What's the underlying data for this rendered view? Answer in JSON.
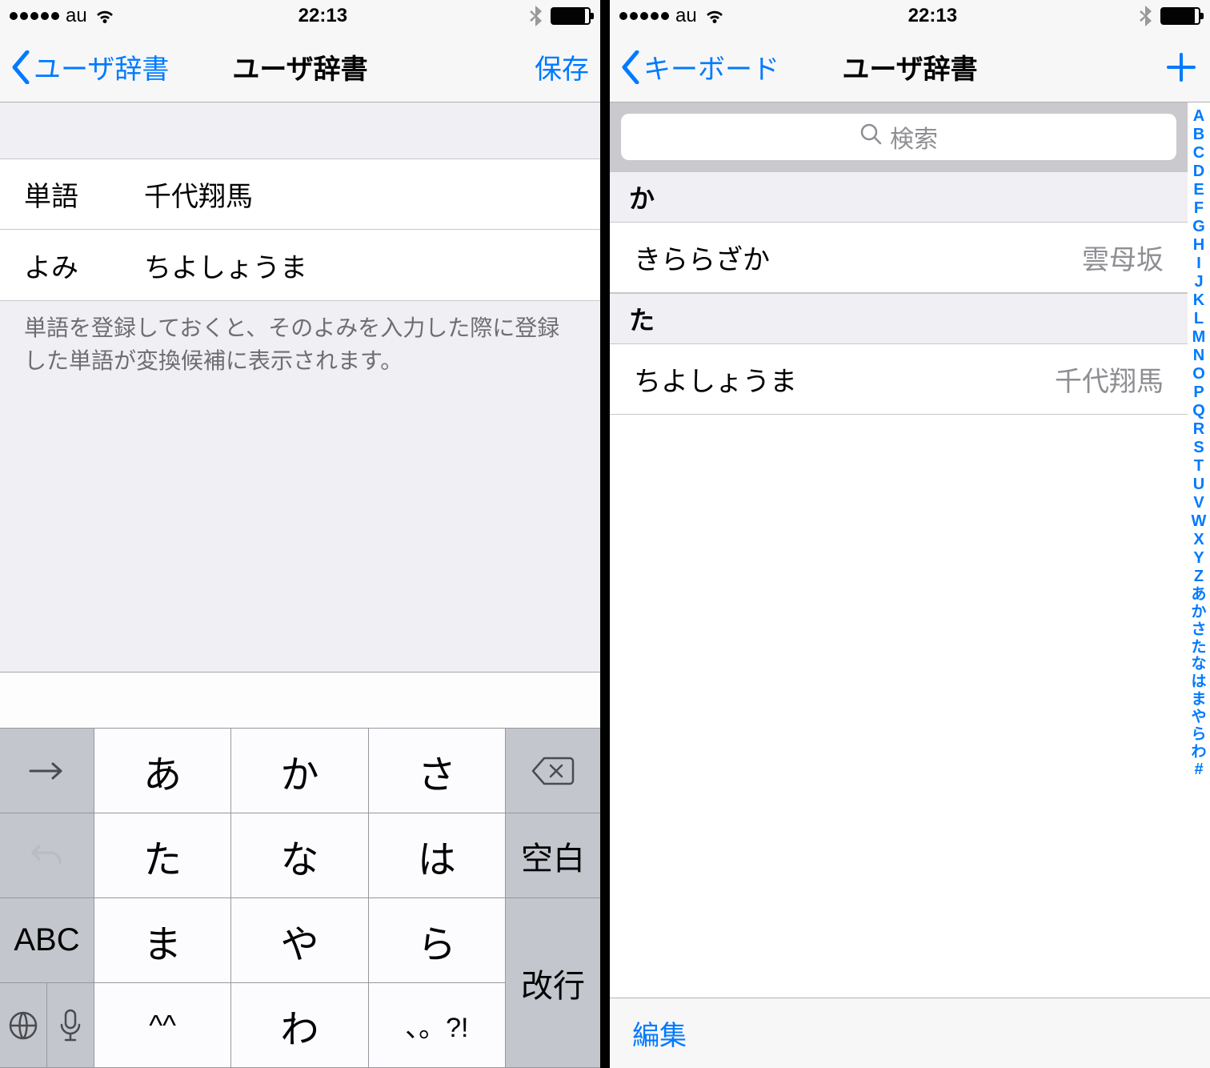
{
  "status": {
    "carrier": "au",
    "time": "22:13"
  },
  "left": {
    "nav": {
      "back": "ユーザ辞書",
      "title": "ユーザ辞書",
      "action": "保存"
    },
    "form": {
      "word_label": "単語",
      "word_value": "千代翔馬",
      "reading_label": "よみ",
      "reading_value": "ちよしょうま",
      "footer": "単語を登録しておくと、そのよみを入力した際に登録した単語が変換候補に表示されます。"
    },
    "keyboard": {
      "left1": "→",
      "left2": "↶",
      "left3": "ABC",
      "left4a_icon": "globe-icon",
      "left4b_icon": "mic-icon",
      "mid": [
        "あ",
        "か",
        "さ",
        "た",
        "な",
        "は",
        "ま",
        "や",
        "ら",
        "^^",
        "わ",
        "、。?!"
      ],
      "right1_icon": "backspace-icon",
      "right2": "空白",
      "right3": "改行"
    }
  },
  "right": {
    "nav": {
      "back": "キーボード",
      "title": "ユーザ辞書"
    },
    "search_placeholder": "検索",
    "sections": [
      {
        "header": "か",
        "rows": [
          {
            "reading": "きららざか",
            "word": "雲母坂"
          }
        ]
      },
      {
        "header": "た",
        "rows": [
          {
            "reading": "ちよしょうま",
            "word": "千代翔馬"
          }
        ]
      }
    ],
    "index": [
      "A",
      "B",
      "C",
      "D",
      "E",
      "F",
      "G",
      "H",
      "I",
      "J",
      "K",
      "L",
      "M",
      "N",
      "O",
      "P",
      "Q",
      "R",
      "S",
      "T",
      "U",
      "V",
      "W",
      "X",
      "Y",
      "Z",
      "あ",
      "か",
      "さ",
      "た",
      "な",
      "は",
      "ま",
      "や",
      "ら",
      "わ",
      "#"
    ],
    "toolbar": {
      "edit": "編集"
    }
  }
}
